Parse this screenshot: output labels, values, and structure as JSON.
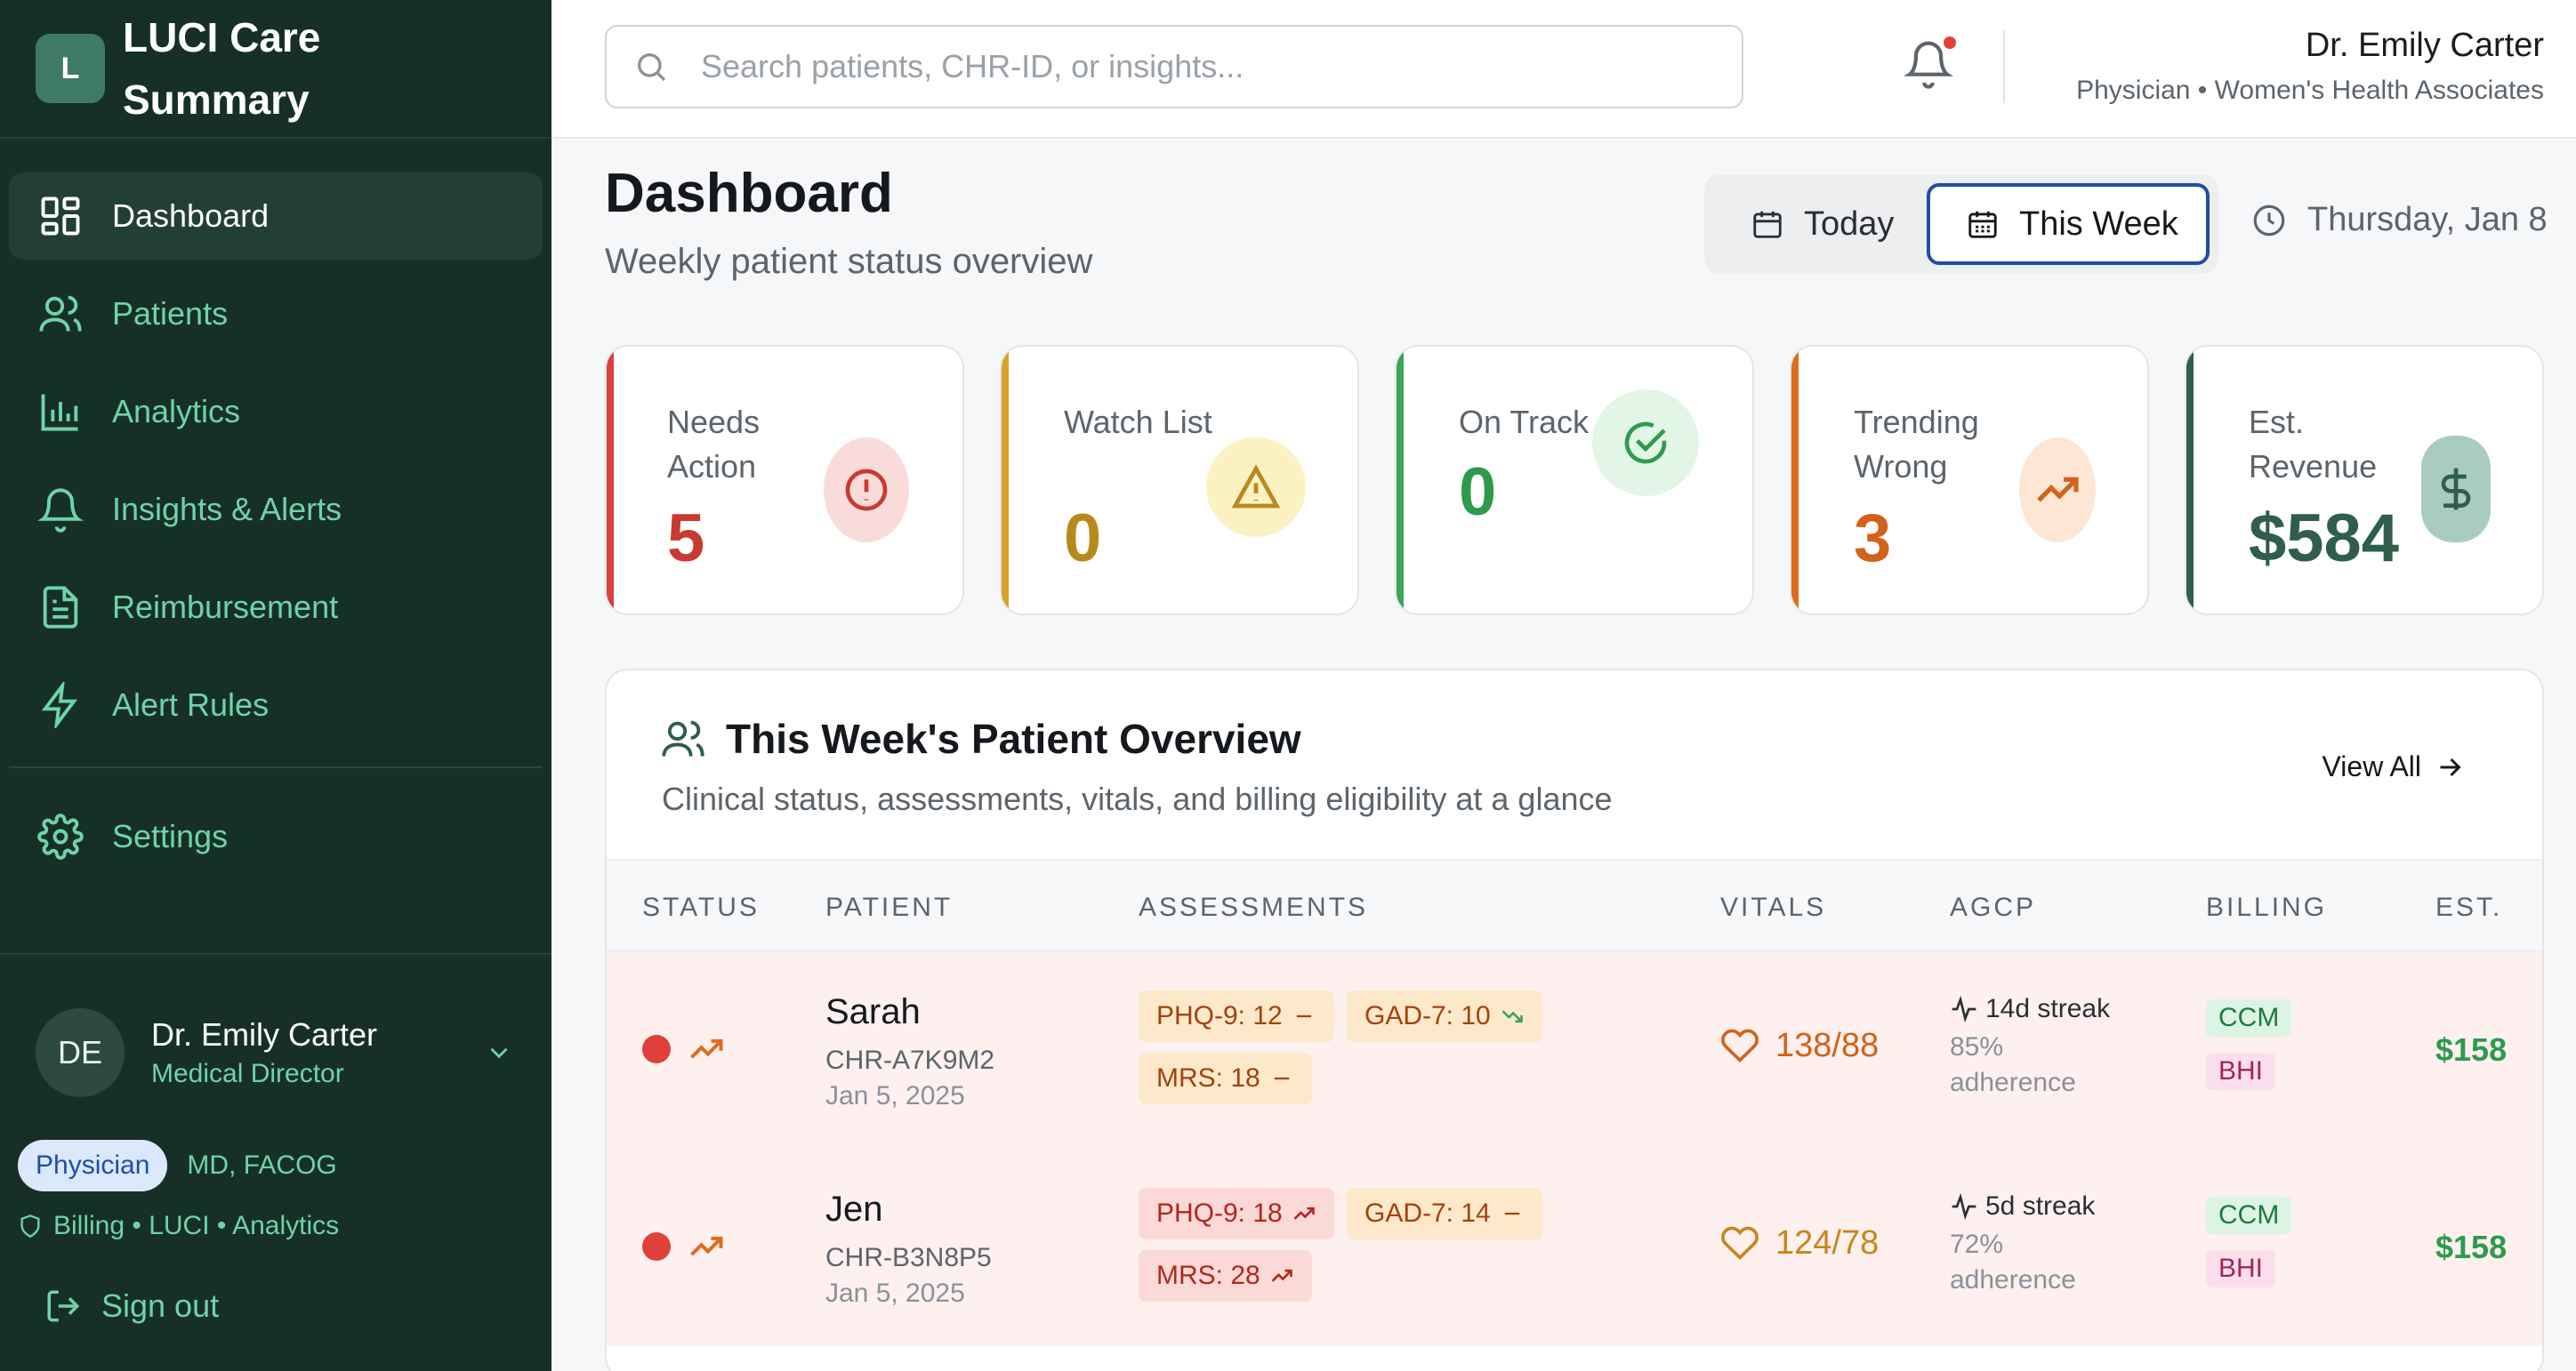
{
  "brand": {
    "logo_letter": "L",
    "title": "LUCI Care Summary"
  },
  "nav": [
    {
      "label": "Dashboard",
      "icon": "grid-icon",
      "active": true
    },
    {
      "label": "Patients",
      "icon": "users-icon"
    },
    {
      "label": "Analytics",
      "icon": "bar-chart-icon"
    },
    {
      "label": "Insights & Alerts",
      "icon": "bell-icon"
    },
    {
      "label": "Reimbursement",
      "icon": "document-icon"
    },
    {
      "label": "Alert Rules",
      "icon": "lightning-icon"
    },
    {
      "label": "Settings",
      "icon": "gear-icon"
    }
  ],
  "sidebar_user": {
    "initials": "DE",
    "name": "Dr. Emily Carter",
    "role": "Medical Director",
    "role_pill": "Physician",
    "credentials": "MD, FACOG",
    "permissions": "Billing • LUCI • Analytics",
    "signout": "Sign out"
  },
  "topbar": {
    "search_placeholder": "Search patients, CHR-ID, or insights...",
    "user_name": "Dr. Emily Carter",
    "user_detail": "Physician • Women's Health Associates"
  },
  "header": {
    "title": "Dashboard",
    "subtitle": "Weekly patient status overview",
    "range_today": "Today",
    "range_week": "This Week",
    "selected_range": "This Week",
    "date": "Thursday, Jan 8"
  },
  "stats": [
    {
      "label": "Needs Action",
      "value": "5",
      "color": "#d9423a",
      "icon": "alert-circle-icon"
    },
    {
      "label": "Watch List",
      "value": "0",
      "color": "#d9a127",
      "icon": "warning-triangle-icon"
    },
    {
      "label": "On Track",
      "value": "0",
      "color": "#3aa557",
      "icon": "check-circle-icon"
    },
    {
      "label": "Trending Wrong",
      "value": "3",
      "color": "#e06b1f",
      "icon": "trending-up-icon"
    },
    {
      "label": "Est. Revenue",
      "value": "$584",
      "color": "#2f5e4b",
      "icon": "dollar-icon"
    }
  ],
  "overview": {
    "title": "This Week's Patient Overview",
    "subtitle": "Clinical status, assessments, vitals, and billing eligibility at a glance",
    "view_all": "View All",
    "columns": [
      "STATUS",
      "PATIENT",
      "ASSESSMENTS",
      "VITALS",
      "AGCP",
      "BILLING",
      "EST."
    ],
    "rows": [
      {
        "name": "Sarah",
        "chr_id": "CHR-A7K9M2",
        "date": "Jan 5, 2025",
        "assessments": [
          {
            "label": "PHQ-9: 12",
            "trend": "flat",
            "tone": "amber"
          },
          {
            "label": "GAD-7: 10",
            "trend": "down",
            "tone": "amber"
          },
          {
            "label": "MRS: 18",
            "trend": "flat",
            "tone": "amber"
          }
        ],
        "vitals": "138/88",
        "streak": "14d streak",
        "adherence": "85% adherence",
        "billing": [
          "CCM",
          "BHI"
        ],
        "est": "$158"
      },
      {
        "name": "Jen",
        "chr_id": "CHR-B3N8P5",
        "date": "Jan 5, 2025",
        "assessments": [
          {
            "label": "PHQ-9: 18",
            "trend": "up",
            "tone": "red"
          },
          {
            "label": "GAD-7: 14",
            "trend": "flat",
            "tone": "amber"
          },
          {
            "label": "MRS: 28",
            "trend": "up",
            "tone": "red"
          }
        ],
        "vitals": "124/78",
        "streak": "5d streak",
        "adherence": "72% adherence",
        "billing": [
          "CCM",
          "BHI"
        ],
        "est": "$158"
      }
    ]
  }
}
